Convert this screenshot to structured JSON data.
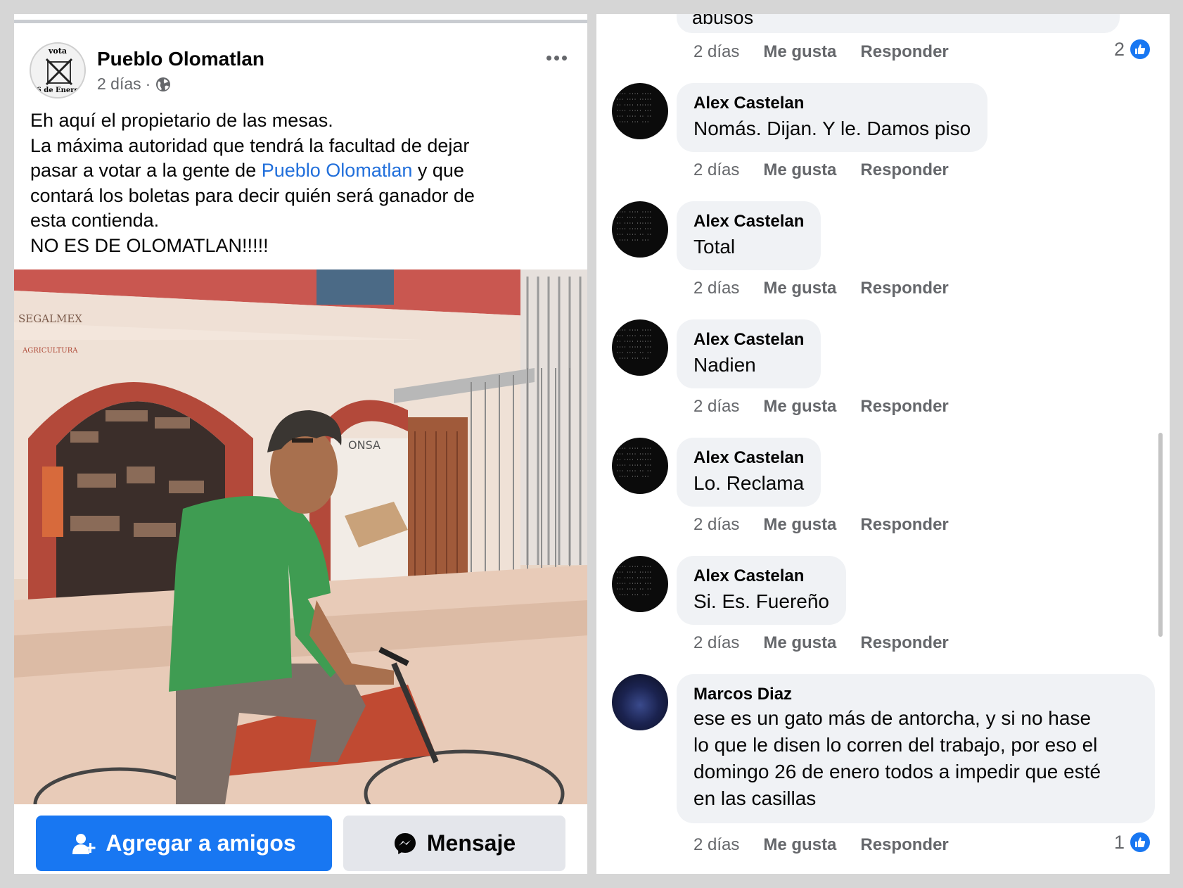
{
  "post": {
    "page_name": "Pueblo Olomatlan",
    "time": "2 días",
    "separator": "·",
    "avatar_text_top": "vota",
    "avatar_text_bottom": "6 de Enero",
    "text_line1": "Eh aquí el propietario de las mesas.",
    "text_line2": "La máxima autoridad que tendrá la facultad de dejar",
    "text_line3_before": "pasar a votar a la gente de ",
    "text_line3_link": "Pueblo Olomatlan",
    "text_line3_after": " y que",
    "text_line4": "contará los boletas para decir quién será ganador de",
    "text_line5": "esta contienda.",
    "text_line6": "NO ES DE OLOMATLAN!!!!!",
    "photo_signs": {
      "sign1": "SEGALMEX",
      "sign2": "AGRICULTURA",
      "sign3": "ONSA"
    }
  },
  "buttons": {
    "add_friend": "Agregar a amigos",
    "message": "Mensaje"
  },
  "comments_top": {
    "partial_text": "abusos",
    "time": "2 días",
    "like": "Me gusta",
    "reply": "Responder",
    "reactions": "2"
  },
  "comments": [
    {
      "author": "Alex Castelan",
      "text": "Nomás. Dijan. Y le. Damos piso",
      "time": "2 días",
      "like": "Me gusta",
      "reply": "Responder"
    },
    {
      "author": "Alex Castelan",
      "text": "Total",
      "time": "2 días",
      "like": "Me gusta",
      "reply": "Responder"
    },
    {
      "author": "Alex Castelan",
      "text": "Nadien",
      "time": "2 días",
      "like": "Me gusta",
      "reply": "Responder"
    },
    {
      "author": "Alex Castelan",
      "text": "Lo. Reclama",
      "time": "2 días",
      "like": "Me gusta",
      "reply": "Responder"
    },
    {
      "author": "Alex Castelan",
      "text": "Si. Es. Fuereño",
      "time": "2 días",
      "like": "Me gusta",
      "reply": "Responder"
    },
    {
      "author": "Marcos Diaz",
      "text_line1": "ese es un gato más de antorcha, y si no hase",
      "text_line2": "lo que le disen lo corren del trabajo, por eso el",
      "text_line3": "domingo 26 de enero todos a impedir que esté",
      "text_line4": "en las casillas",
      "time": "2 días",
      "like": "Me gusta",
      "reply": "Responder",
      "reactions": "1"
    }
  ],
  "colors": {
    "facebook_blue": "#1877f2",
    "link_blue": "#216fdb",
    "bubble_gray": "#f0f2f5",
    "secondary_text": "#65676b"
  },
  "icons": {
    "more": "more-dots-icon",
    "privacy": "globe-icon",
    "add_friend": "add-person-icon",
    "message": "messenger-icon",
    "like": "thumbs-up-icon"
  }
}
